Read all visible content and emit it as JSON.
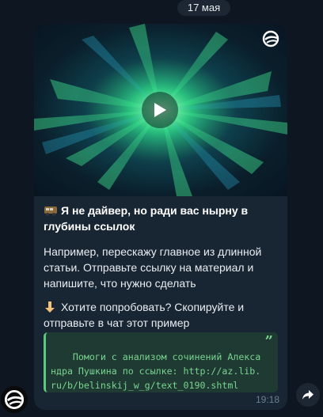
{
  "chat": {
    "date_label": "17 мая"
  },
  "message": {
    "title_emoji": "bus-icon",
    "title": "Я не дайвер, но ради вас нырну в глубины ссылок",
    "paragraph1": "Например, перескажу главное из длинной статьи. Отправьте ссылку на материал и напишите, что нужно сделать",
    "paragraph2_emoji": "pointing-down-icon",
    "paragraph2": "Хотите попробовать? Скопируйте и отправьте в чат этот пример",
    "quote": "Помоги с анализом сочинений Александра Пушкина по ссылке: http://az.lib.ru/b/belinskij_w_g/text_0190.shtml",
    "quote_mark": "”",
    "time": "19:18"
  },
  "icons": {
    "play": "play-icon",
    "brand": "brand-logo-icon",
    "share": "share-arrow-icon"
  },
  "colors": {
    "background": "#0e1621",
    "bubble": "#182533",
    "accent_green": "#5dc97b"
  }
}
